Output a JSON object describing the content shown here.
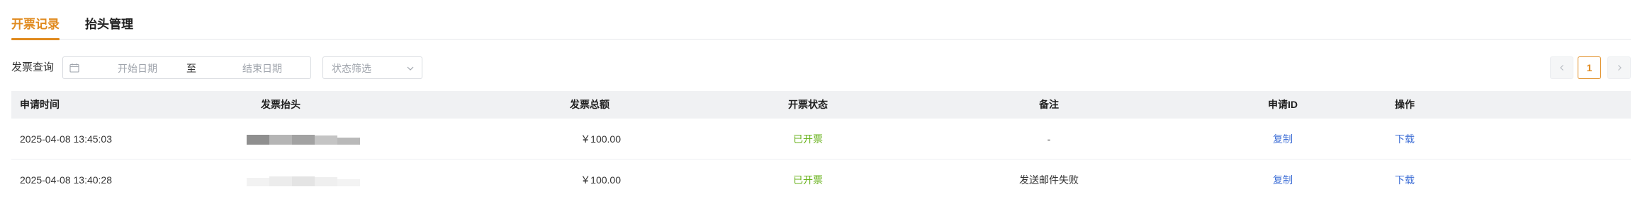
{
  "tabs": [
    {
      "label": "开票记录",
      "active": true
    },
    {
      "label": "抬头管理",
      "active": false
    }
  ],
  "filters": {
    "label": "发票查询",
    "start_placeholder": "开始日期",
    "range_separator": "至",
    "end_placeholder": "结束日期",
    "status_placeholder": "状态筛选"
  },
  "pagination": {
    "current_page": "1"
  },
  "table": {
    "headers": {
      "time": "申请时间",
      "title": "发票抬头",
      "amount": "发票总额",
      "status": "开票状态",
      "note": "备注",
      "request_id": "申请ID",
      "action": "操作"
    },
    "rows": [
      {
        "time": "2025-04-08 13:45:03",
        "amount": "￥100.00",
        "status": "已开票",
        "note": "-",
        "request_id": "复制",
        "action": "下载"
      },
      {
        "time": "2025-04-08 13:40:28",
        "amount": "￥100.00",
        "status": "已开票",
        "note": "发送邮件失败",
        "request_id": "复制",
        "action": "下载"
      }
    ]
  },
  "colors": {
    "accent": "#e08a1e",
    "status_green": "#67b21a",
    "link_blue": "#3f6fd6",
    "header_bg": "#f0f1f3"
  },
  "icons": [
    "calendar-icon",
    "chevron-down-icon",
    "chevron-left-icon",
    "chevron-right-icon"
  ]
}
